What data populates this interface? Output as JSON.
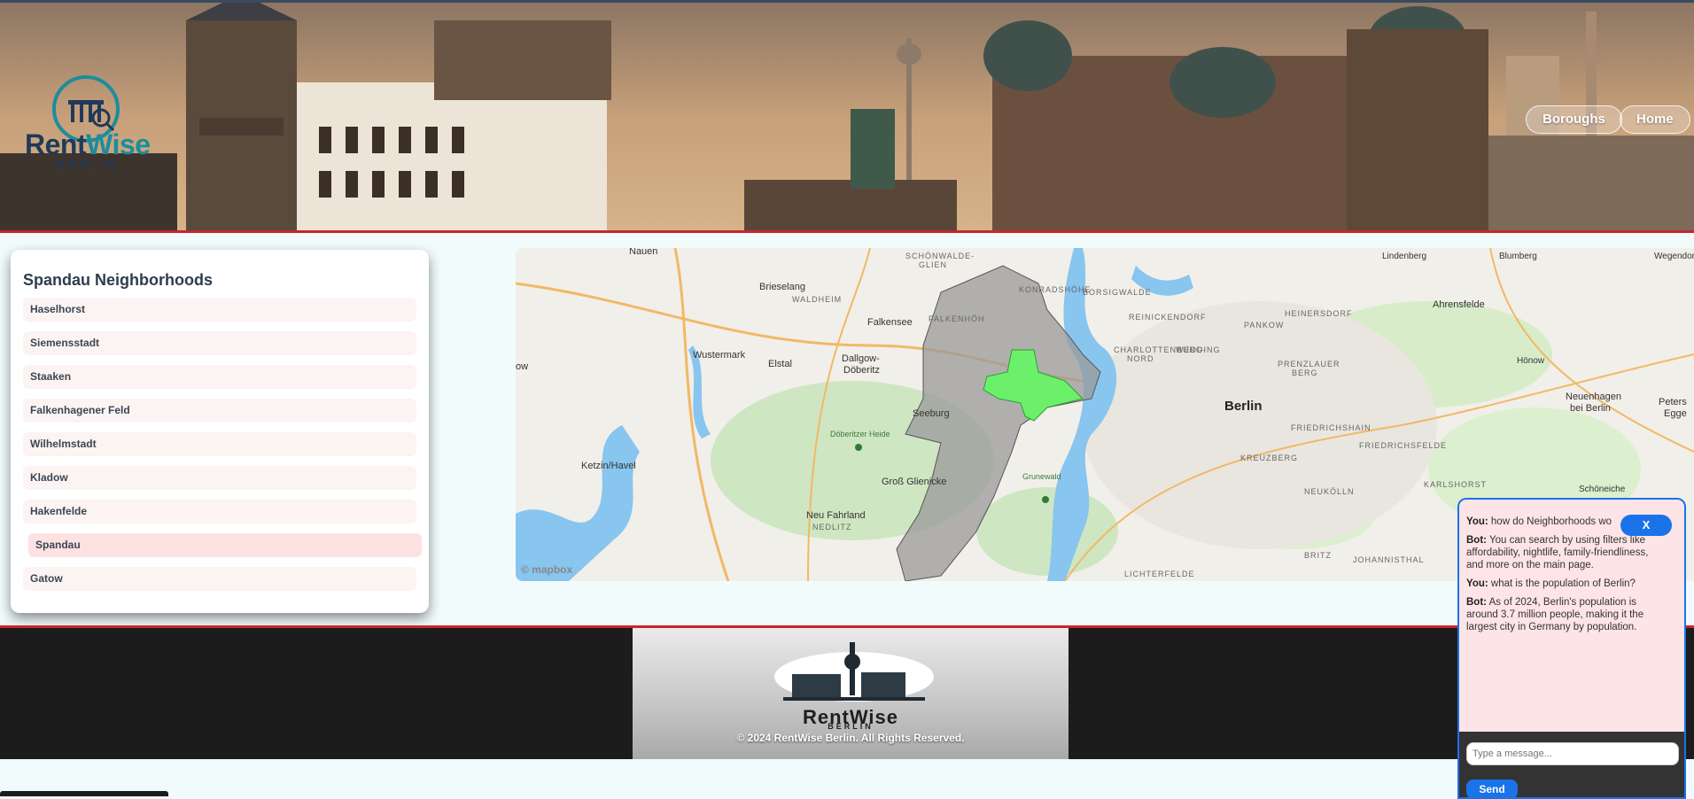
{
  "header": {
    "brand_main": "Rent",
    "brand_accent": "Wise",
    "brand_sub": "BERLIN",
    "nav": [
      {
        "label": "Boroughs"
      },
      {
        "label": "Home"
      }
    ]
  },
  "neighborhoods": {
    "title": "Spandau Neighborhoods",
    "items": [
      {
        "label": "Haselhorst"
      },
      {
        "label": "Siemensstadt"
      },
      {
        "label": "Staaken"
      },
      {
        "label": "Falkenhagener Feld"
      },
      {
        "label": "Wilhelmstadt"
      },
      {
        "label": "Kladow"
      },
      {
        "label": "Hakenfelde"
      },
      {
        "label": "Spandau",
        "active": true
      },
      {
        "label": "Gatow"
      }
    ]
  },
  "map": {
    "attribution": "© mapbox",
    "labels": {
      "nauen": "Nauen",
      "brieselang": "Brieselang",
      "waldheim": "WALDHEIM",
      "falkensee": "Falkensee",
      "wustermark": "Wustermark",
      "elstal": "Elstal",
      "dallgow": "Dallgow-",
      "doberitz": "Döberitz",
      "seeburg": "Seeburg",
      "doberitzer_heide": "Döberitzer Heide",
      "ketzin": "Ketzin/Havel",
      "gross_glienicke": "Groß Glienicke",
      "neu_fahrland": "Neu Fahrland",
      "grunewald": "Grunewald",
      "berlin": "Berlin",
      "lindenberg": "Lindenberg",
      "blumberg": "Blumberg",
      "wegendorf": "Wegendor",
      "ahrensfelde": "Ahrensfelde",
      "hoenow": "Hönow",
      "neuenhagen": "Neuenhagen",
      "bei_berlin": "bei Berlin",
      "schoeneiche": "Schöneiche",
      "petershagen": "Peters",
      "eggersdorf": "Egge",
      "friedrichshain": "FRIEDRICHSHAIN",
      "friedrichsfelde": "FRIEDRICHSFELDE",
      "karlshorst": "KARLSHORST",
      "kreuzberg": "KREUZBERG",
      "neukoelln": "NEUKÖLLN",
      "johannisthal": "JOHANNISTHAL",
      "britz": "BRITZ",
      "lichterfelde": "LICHTERFELDE",
      "wedding": "WEDDING",
      "pankow": "PANKOW",
      "heinersdorf": "HEINERSDORF",
      "prenzlauer": "PRENZLAUER",
      "berg": "BERG",
      "reinickendorf": "REINICKENDORF",
      "borsigwalde": "BORSIGWALDE",
      "konradshoehe": "KONRADSHÖHE",
      "schoenwalde": "SCHÖNWALDE-",
      "glien": "GLIEN",
      "falkenhoeh": "FALKENHÖH",
      "charlottenburg": "CHARLOTTENBURG-",
      "nord": "NORD",
      "nedlitz": "NEDLITZ",
      "ow": "ow"
    }
  },
  "footer": {
    "brand": "RentWise",
    "brand_sub": "BERLIN",
    "copyright": "© 2024 RentWise Berlin. All Rights Reserved."
  },
  "chat": {
    "messages": [
      {
        "speaker": "You:",
        "text": "how do Neighborhoods wo"
      },
      {
        "speaker": "Bot:",
        "text": "You can search by using filters like affordability, nightlife, family-friendliness, and more on the main page."
      },
      {
        "speaker": "You:",
        "text": "what is the population of Berlin?"
      },
      {
        "speaker": "Bot:",
        "text": "As of 2024, Berlin's population is around 3.7 million people, making it the largest city in Germany by population."
      }
    ],
    "close_label": "X",
    "input_placeholder": "Type a message...",
    "send_label": "Send"
  },
  "colors": {
    "accent_blue": "#1a73e8",
    "footer_red": "#c8262c",
    "highlight_green": "#6cf06c"
  }
}
